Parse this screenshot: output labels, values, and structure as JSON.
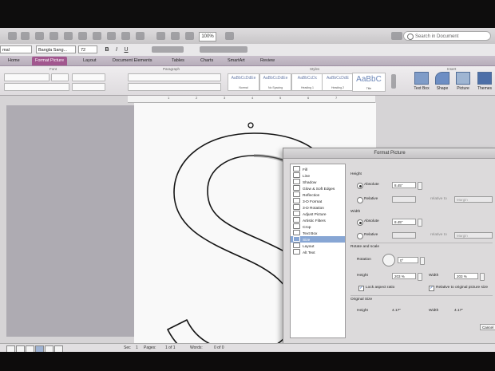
{
  "app": {
    "zoom": "100%",
    "search_placeholder": "Search in Document",
    "font_name": "Bangla Sang...",
    "font_size": "72",
    "style_name": "mal"
  },
  "tabs": [
    "Home",
    "Format Picture",
    "Layout",
    "Document Elements",
    "Tables",
    "Charts",
    "SmartArt",
    "Review"
  ],
  "ribbon": {
    "groups": [
      "Font",
      "Paragraph",
      "Styles",
      "Insert"
    ],
    "styles": [
      {
        "sample": "AaBbCcDdEe",
        "caption": "Normal"
      },
      {
        "sample": "AaBbCcDdEe",
        "caption": "No Spacing"
      },
      {
        "sample": "AaBbCcDc",
        "caption": "Heading 1"
      },
      {
        "sample": "AaBbCcDdE",
        "caption": "Heading 2"
      },
      {
        "sample": "AaBbC",
        "caption": "Title"
      }
    ],
    "insert_buttons": [
      "Text Box",
      "Shape",
      "Picture",
      "Themes"
    ]
  },
  "ruler_ticks": [
    "1",
    "2",
    "3",
    "4",
    "5",
    "6",
    "7"
  ],
  "dialog": {
    "title": "Format Picture",
    "categories": [
      "Fill",
      "Line",
      "Shadow",
      "Glow & Soft Edges",
      "Reflection",
      "3-D Format",
      "3-D Rotation",
      "Adjust Picture",
      "Artistic Filters",
      "Crop",
      "Text Box",
      "Size",
      "Layout",
      "Alt Text"
    ],
    "selected_category": "Size",
    "height_section": "Height",
    "width_section": "Width",
    "absolute_label": "Absolute",
    "relative_label": "Relative",
    "height_absolute_value": "8.45\"",
    "width_absolute_value": "8.45\"",
    "relative_to_label": "relative to",
    "relative_to_value": "Margin",
    "rotate_scale_section": "Rotate and scale",
    "rotation_label": "Rotation",
    "rotation_value": "0°",
    "scale_height_label": "Height",
    "scale_height_value": "203 %",
    "scale_width_label": "Width",
    "scale_width_value": "203 %",
    "lock_aspect_label": "Lock aspect ratio",
    "relative_original_label": "Relative to original picture size",
    "original_size_section": "Original Size",
    "orig_height_label": "Height",
    "orig_height_value": "4.17\"",
    "orig_width_label": "Width",
    "orig_width_value": "4.17\"",
    "cancel_label": "Cancel"
  },
  "statusbar": {
    "sec": "Sec",
    "sec_num": "1",
    "pages_label": "Pages:",
    "pages_value": "1 of 1",
    "words_label": "Words:",
    "words_value": "0 of 0"
  }
}
